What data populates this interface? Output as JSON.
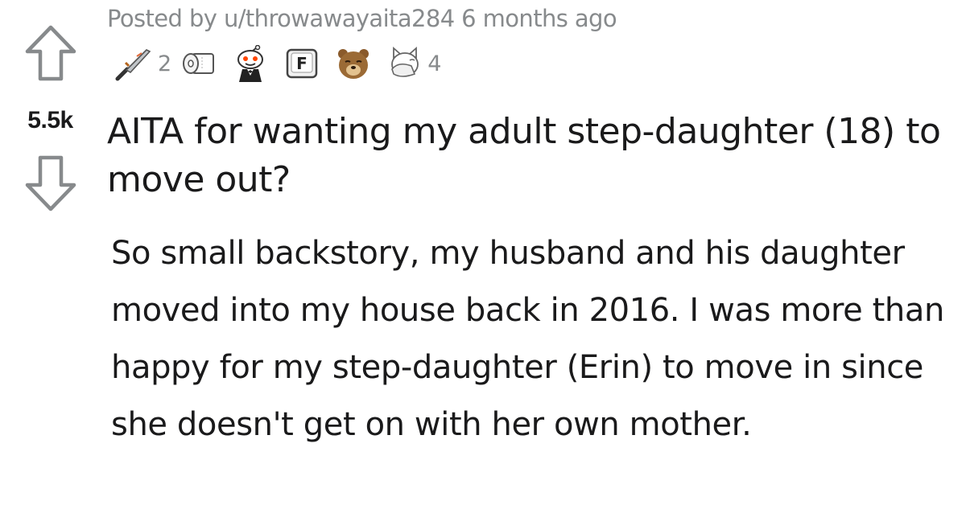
{
  "post": {
    "posted_by_prefix": "Posted by",
    "author": "u/throwawayaita284",
    "age": "6 months ago",
    "score": "5.5k",
    "title": "AITA for wanting my adult step-daughter (18) to move out?",
    "body": "So small backstory, my husband and his daughter moved into my house back in 2016. I was more than happy for my step-daughter (Erin) to move in since she doesn't get on with her own mother."
  },
  "awards": [
    {
      "icon": "knife-award-icon",
      "count": "2"
    },
    {
      "icon": "toilet-paper-award-icon",
      "count": ""
    },
    {
      "icon": "snoo-tuxedo-award-icon",
      "count": ""
    },
    {
      "icon": "press-f-award-icon",
      "count": ""
    },
    {
      "icon": "bear-award-icon",
      "count": ""
    },
    {
      "icon": "facepalm-cat-award-icon",
      "count": "4"
    }
  ],
  "colors": {
    "meta_text": "#878a8c",
    "body_text": "#1a1a1b",
    "vote_arrow": "#878a8c"
  }
}
